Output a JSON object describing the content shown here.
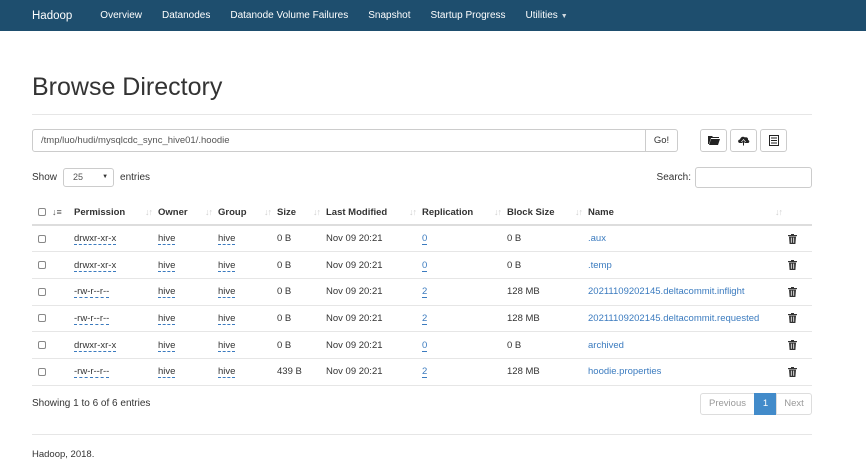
{
  "navbar": {
    "brand": "Hadoop",
    "items": [
      {
        "label": "Overview"
      },
      {
        "label": "Datanodes"
      },
      {
        "label": "Datanode Volume Failures"
      },
      {
        "label": "Snapshot"
      },
      {
        "label": "Startup Progress"
      },
      {
        "label": "Utilities"
      }
    ]
  },
  "page": {
    "title": "Browse Directory",
    "path_value": "/tmp/luo/hudi/mysqlcdc_sync_hive01/.hoodie",
    "go_label": "Go!",
    "toolbar_icons": [
      "folder-icon",
      "upload-icon",
      "list-icon"
    ]
  },
  "controls": {
    "show_label": "Show",
    "entries_value": "25",
    "entries_label": "entries",
    "search_label": "Search:"
  },
  "table": {
    "headers": [
      "Permission",
      "Owner",
      "Group",
      "Size",
      "Last Modified",
      "Replication",
      "Block Size",
      "Name"
    ],
    "rows": [
      {
        "permission": "drwxr-xr-x",
        "owner": "hive",
        "group": "hive",
        "size": "0 B",
        "modified": "Nov 09 20:21",
        "replication": "0",
        "block_size": "0 B",
        "name": ".aux"
      },
      {
        "permission": "drwxr-xr-x",
        "owner": "hive",
        "group": "hive",
        "size": "0 B",
        "modified": "Nov 09 20:21",
        "replication": "0",
        "block_size": "0 B",
        "name": ".temp"
      },
      {
        "permission": "-rw-r--r--",
        "owner": "hive",
        "group": "hive",
        "size": "0 B",
        "modified": "Nov 09 20:21",
        "replication": "2",
        "block_size": "128 MB",
        "name": "20211109202145.deltacommit.inflight"
      },
      {
        "permission": "-rw-r--r--",
        "owner": "hive",
        "group": "hive",
        "size": "0 B",
        "modified": "Nov 09 20:21",
        "replication": "2",
        "block_size": "128 MB",
        "name": "20211109202145.deltacommit.requested"
      },
      {
        "permission": "drwxr-xr-x",
        "owner": "hive",
        "group": "hive",
        "size": "0 B",
        "modified": "Nov 09 20:21",
        "replication": "0",
        "block_size": "0 B",
        "name": "archived"
      },
      {
        "permission": "-rw-r--r--",
        "owner": "hive",
        "group": "hive",
        "size": "439 B",
        "modified": "Nov 09 20:21",
        "replication": "2",
        "block_size": "128 MB",
        "name": "hoodie.properties"
      }
    ]
  },
  "pagination": {
    "info": "Showing 1 to 6 of 6 entries",
    "previous": "Previous",
    "current": "1",
    "next": "Next"
  },
  "footer": {
    "copyright": "Hadoop, 2018."
  },
  "colors": {
    "navbar_bg": "#1e4e6e",
    "link": "#3b7bbf",
    "active_page": "#428bca"
  }
}
